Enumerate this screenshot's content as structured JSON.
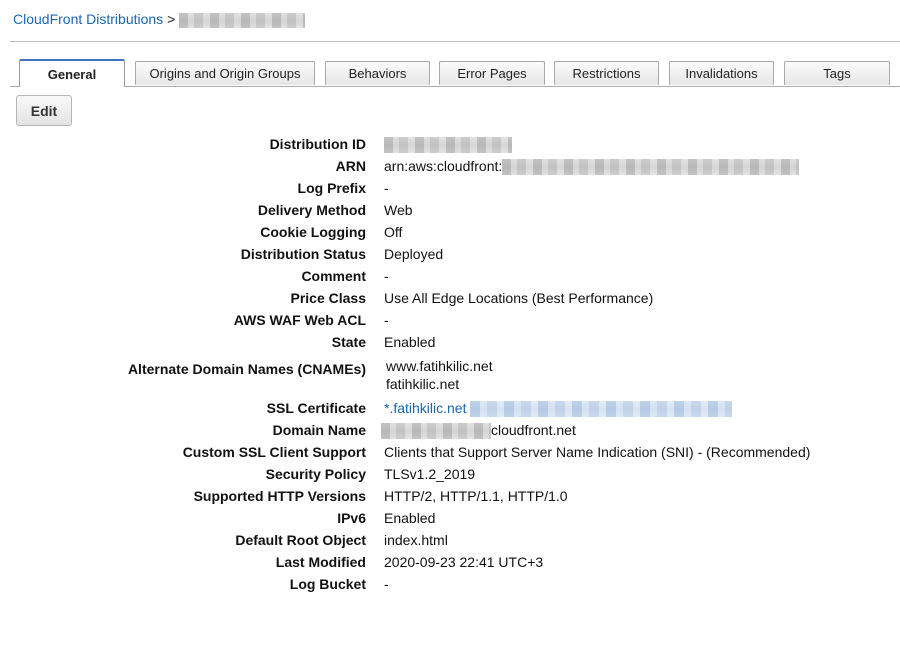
{
  "breadcrumb": {
    "root": "CloudFront Distributions",
    "separator": ">"
  },
  "tabs": [
    {
      "label": "General",
      "active": true
    },
    {
      "label": "Origins and Origin Groups",
      "active": false
    },
    {
      "label": "Behaviors",
      "active": false
    },
    {
      "label": "Error Pages",
      "active": false
    },
    {
      "label": "Restrictions",
      "active": false
    },
    {
      "label": "Invalidations",
      "active": false
    },
    {
      "label": "Tags",
      "active": false
    }
  ],
  "edit_label": "Edit",
  "details": {
    "distribution_id": {
      "label": "Distribution ID"
    },
    "arn": {
      "label": "ARN",
      "value_prefix": "arn:aws:cloudfront:"
    },
    "log_prefix": {
      "label": "Log Prefix",
      "value": "-"
    },
    "delivery_method": {
      "label": "Delivery Method",
      "value": "Web"
    },
    "cookie_logging": {
      "label": "Cookie Logging",
      "value": "Off"
    },
    "distribution_status": {
      "label": "Distribution Status",
      "value": "Deployed"
    },
    "comment": {
      "label": "Comment",
      "value": "-"
    },
    "price_class": {
      "label": "Price Class",
      "value": "Use All Edge Locations (Best Performance)"
    },
    "waf": {
      "label": "AWS WAF Web ACL",
      "value": "-"
    },
    "state": {
      "label": "State",
      "value": "Enabled"
    },
    "cnames": {
      "label": "Alternate Domain Names (CNAMEs)",
      "values": [
        "www.fatihkilic.net",
        "fatihkilic.net"
      ]
    },
    "ssl_certificate": {
      "label": "SSL Certificate",
      "link_text": "*.fatihkilic.net"
    },
    "domain_name": {
      "label": "Domain Name",
      "value_suffix": "cloudfront.net"
    },
    "custom_ssl": {
      "label": "Custom SSL Client Support",
      "value": "Clients that Support Server Name Indication (SNI) - (Recommended)"
    },
    "security_policy": {
      "label": "Security Policy",
      "value": "TLSv1.2_2019"
    },
    "http_versions": {
      "label": "Supported HTTP Versions",
      "value": "HTTP/2, HTTP/1.1, HTTP/1.0"
    },
    "ipv6": {
      "label": "IPv6",
      "value": "Enabled"
    },
    "default_root": {
      "label": "Default Root Object",
      "value": "index.html"
    },
    "last_modified": {
      "label": "Last Modified",
      "value": "2020-09-23 22:41 UTC+3"
    },
    "log_bucket": {
      "label": "Log Bucket",
      "value": "-"
    }
  },
  "colors": {
    "link": "#1a66b3",
    "active_tab_border": "#3b74b8"
  }
}
